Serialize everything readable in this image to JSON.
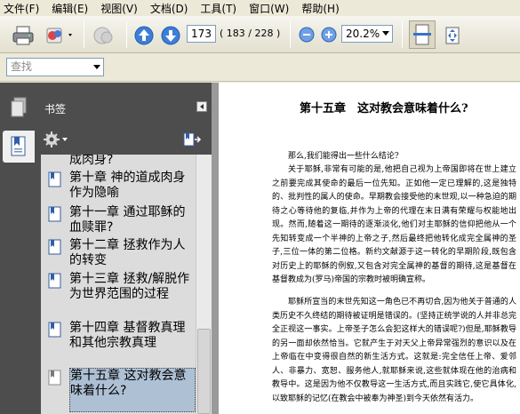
{
  "menu": [
    {
      "label": "文件(F)"
    },
    {
      "label": "编辑(E)"
    },
    {
      "label": "视图(V)"
    },
    {
      "label": "文档(D)"
    },
    {
      "label": "工具(T)"
    },
    {
      "label": "窗口(W)"
    },
    {
      "label": "帮助(H)"
    }
  ],
  "toolbar": {
    "page_number": "173",
    "page_count": "( 183 / 228 )",
    "zoom": "20.2%"
  },
  "find": {
    "placeholder": "查找"
  },
  "bookmarks_panel": {
    "title": "书签",
    "items": [
      {
        "label": "成肉身?"
      },
      {
        "label": "第十章 神的道成肉身作为隐喻"
      },
      {
        "label": "第十一章 通过耶稣的血赎罪?"
      },
      {
        "label": "第十二章 拯救作为人的转变"
      },
      {
        "label": "第十三章 拯救/解脱作为世界范围的过程"
      },
      {
        "label": "第十四章 基督教真理和其他宗教真理"
      },
      {
        "label": "第十五章 这对教会意味着什么?"
      }
    ]
  },
  "document": {
    "chapter_title": "第十五章　这对教会意味着什么?",
    "paragraphs": [
      "那么,我们能得出一些什么结论?",
      "关于耶稣,非常有可能的是,他把自己视为上帝国即将在世上建立之前要完成其使命的最后一位先知。正如他一定已理解的,这是独特的、批判性的属人的使命。早期教会接受他的末世观,以一种急迫的期待之心等待他的复临,并作为上帝的代理在末日满有荣耀与权能地出现。然而,随着这一期待的逐渐淡化,他们对主耶稣的信仰把他从一个先知转变成一个半神的上帝之子,然后最终把他转化成完全属神的圣子,三位一体的第二位格。新约文献源于这一转化的早期阶段,既包含对历史上的耶稣的例叙,又包含对完全属神的基督的期待,这是基督在基督教成为(罗马)帝国的宗教时被明确宣称。",
      "耶稣所宣当的末世先知这一角色已不再切合,因为他关于普通的人类历史不久终结的期待被证明是错误的。(坚持正统学说的人并非总完全正视这一事实。上帝圣子怎么会犯这样大的错误呢?)但是,耶稣教导的另一面却依然恰当。它就产生于对天父上帝异常强烈的意识以及在上帝临在中变得很自然的新生活方式。这就是:完全信任上帝、爱邻人、非暴力、宽恕、服务他人,就耶稣来说,这些就体现在他的治病和教导中。这是因为他不仅教导这一生活方式,而且实践它,使它具体化,以致耶稣的记忆(在教会中被奉为神圣)到今天依然有活力。"
    ]
  }
}
